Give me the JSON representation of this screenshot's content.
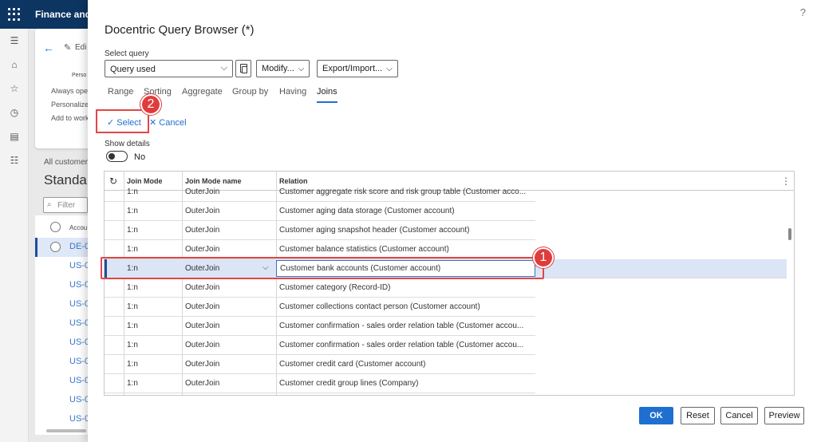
{
  "app": {
    "name": "Finance and"
  },
  "background": {
    "edit_label": "Edi",
    "personalize_header": "Perso",
    "always_open": "Always ope",
    "personalize": "Personalize",
    "add_to_work": "Add to work",
    "all_customers": "All customer",
    "page_title": "Standa",
    "filter_placeholder": "Filter",
    "column_header": "Accou",
    "rows": [
      "DE-0",
      "US-0",
      "US-0",
      "US-0",
      "US-0",
      "US-0",
      "US-0",
      "US-0",
      "US-0",
      "US-0"
    ]
  },
  "dialog": {
    "title": "Docentric Query Browser (*)",
    "help": "?",
    "select_query_label": "Select query",
    "select_query_value": "Query used",
    "modify_label": "Modify...",
    "export_import_label": "Export/Import...",
    "tabs": [
      "Range",
      "Sorting",
      "Aggregate",
      "Group by",
      "Having",
      "Joins"
    ],
    "active_tab": "Joins",
    "actions": {
      "select": "Select",
      "cancel": "Cancel"
    },
    "show_details_label": "Show details",
    "show_details_value": "No",
    "badges": {
      "one": "1",
      "two": "2"
    },
    "grid": {
      "headers": {
        "join_mode": "Join Mode",
        "join_mode_name": "Join Mode name",
        "relation": "Relation"
      },
      "rows": [
        {
          "mode": "1:n",
          "name": "OuterJoin",
          "relation": "Customer aggregate risk score and risk group table  (Customer acco..."
        },
        {
          "mode": "1:n",
          "name": "OuterJoin",
          "relation": "Customer aging data storage  (Customer account)"
        },
        {
          "mode": "1:n",
          "name": "OuterJoin",
          "relation": "Customer aging snapshot header  (Customer account)"
        },
        {
          "mode": "1:n",
          "name": "OuterJoin",
          "relation": "Customer balance statistics  (Customer account)"
        },
        {
          "mode": "1:n",
          "name": "OuterJoin",
          "relation": "Customer bank accounts  (Customer account)"
        },
        {
          "mode": "1:n",
          "name": "OuterJoin",
          "relation": "Customer category  (Record-ID)"
        },
        {
          "mode": "1:n",
          "name": "OuterJoin",
          "relation": "Customer collections contact person  (Customer account)"
        },
        {
          "mode": "1:n",
          "name": "OuterJoin",
          "relation": "Customer confirmation - sales order relation table  (Customer accou..."
        },
        {
          "mode": "1:n",
          "name": "OuterJoin",
          "relation": "Customer confirmation - sales order relation table  (Customer accou..."
        },
        {
          "mode": "1:n",
          "name": "OuterJoin",
          "relation": "Customer credit card  (Customer account)"
        },
        {
          "mode": "1:n",
          "name": "OuterJoin",
          "relation": "Customer credit group lines  (Company)"
        }
      ]
    },
    "footer": {
      "ok": "OK",
      "reset": "Reset",
      "cancel": "Cancel",
      "preview": "Preview"
    }
  }
}
